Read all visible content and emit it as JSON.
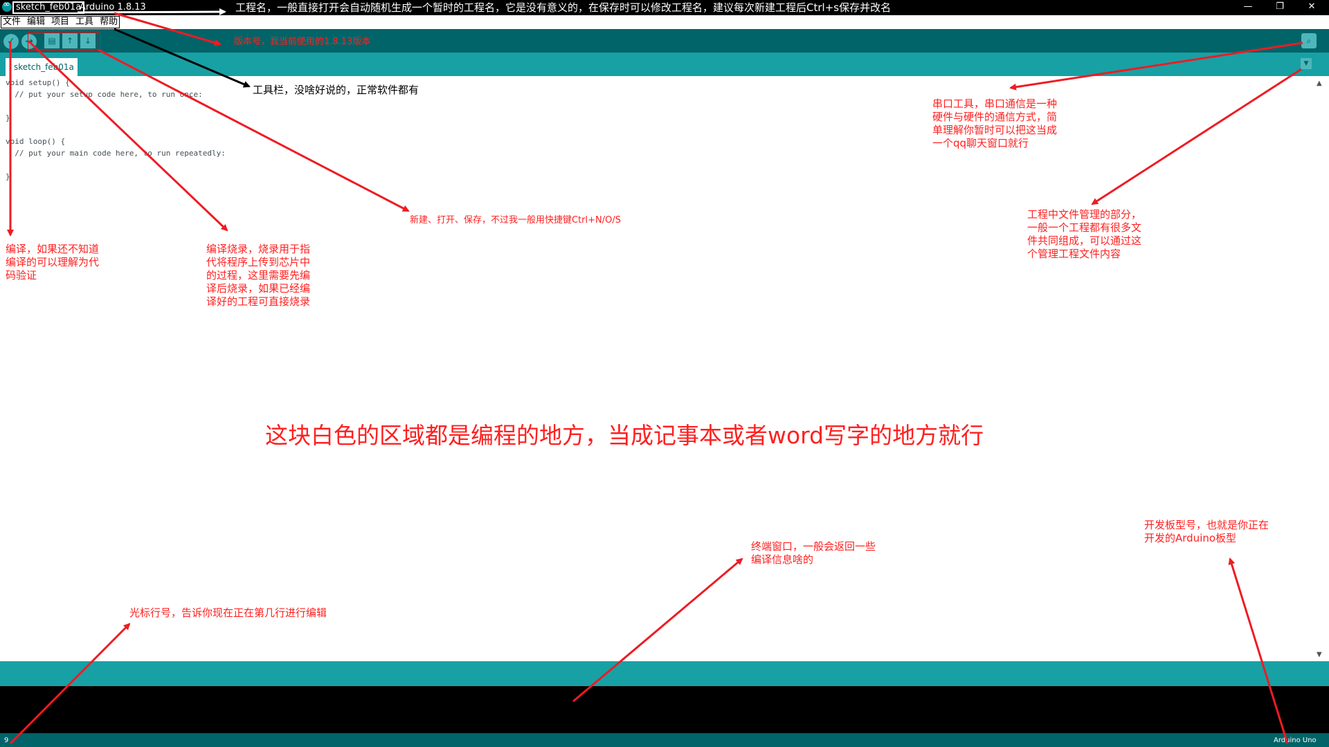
{
  "titlebar": {
    "sketch_name": "sketch_feb01a",
    "version": "Arduino 1.8.13",
    "minimize": "—",
    "restore": "❐",
    "close": "✕"
  },
  "menu": [
    "文件",
    "编辑",
    "项目",
    "工具",
    "帮助"
  ],
  "toolbar": {
    "verify": "✓",
    "upload": "→",
    "new": "▤",
    "open": "↑",
    "save": "↓",
    "serial_monitor": "⌕"
  },
  "tab": {
    "label": "sketch_feb01a",
    "menu": "▼"
  },
  "code": [
    "void setup() {",
    "  // put your setup code here, to run once:",
    "",
    "}",
    "",
    "void loop() {",
    "  // put your main code here, to run repeatedly:",
    "",
    "}"
  ],
  "scroll": {
    "up": "▲",
    "down": "▼"
  },
  "status": {
    "line_number": "9",
    "board": "Arduino Uno"
  },
  "annotations": {
    "project_name": "工程名，一般直接打开会自动随机生成一个暂时的工程名，它是没有意义的，在保存时可以修改工程名，建议每次新建工程后Ctrl+s保存并改名",
    "version_note": "版本号，我当前使用的1.8.13版本",
    "toolbar_note": "工具栏，没啥好说的，正常软件都有",
    "serial_note": [
      "串口工具，串口通信是一种",
      "硬件与硬件的通信方式，简",
      "单理解你暂时可以把这当成",
      "一个qq聊天窗口就行"
    ],
    "file_mgmt_note": [
      "工程中文件管理的部分，",
      "一般一个工程都有很多文",
      "件共同组成，可以通过这",
      "个管理工程文件内容"
    ],
    "new_open_save_note": "新建、打开、保存，不过我一般用快捷键Ctrl+N/O/S",
    "verify_note": [
      "编译，如果还不知道",
      "编译的可以理解为代",
      "码验证"
    ],
    "upload_note": [
      "编译烧录，烧录用于指",
      "代将程序上传到芯片中",
      "的过程，这里需要先编",
      "译后烧录，如果已经编",
      "译好的工程可直接烧录"
    ],
    "editor_note": "这块白色的区域都是编程的地方，当成记事本或者word写字的地方就行",
    "board_note": [
      "开发板型号，也就是你正在",
      "开发的Arduino板型"
    ],
    "console_note": [
      "终端窗口，一般会返回一些",
      "编译信息啥的"
    ],
    "cursor_line_note": "光标行号，告诉你现在正在第几行进行编辑"
  },
  "colors": {
    "annotation_red": "#ff2020",
    "toolbar_teal": "#006468",
    "tabbar_teal": "#17a1a5"
  }
}
